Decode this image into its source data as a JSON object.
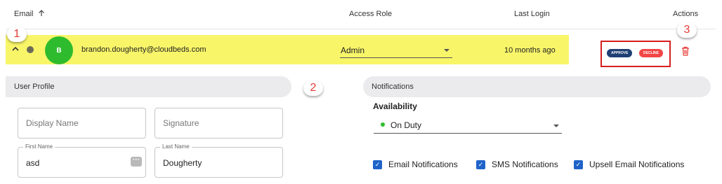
{
  "table": {
    "headers": {
      "email": "Email",
      "access_role": "Access Role",
      "last_login": "Last Login",
      "actions": "Actions"
    },
    "row": {
      "avatar_initial": "B",
      "email": "brandon.dougherty@cloudbeds.com",
      "access_role": "Admin",
      "last_login": "10 months ago",
      "approve_label": "APPROVE",
      "decline_label": "DECLINE"
    }
  },
  "annotations": [
    "1",
    "2",
    "3"
  ],
  "user_profile": {
    "title": "User Profile",
    "display_name_placeholder": "Display Name",
    "signature_placeholder": "Signature",
    "first_name_label": "First Name",
    "first_name_value": "asd",
    "last_name_label": "Last Name",
    "last_name_value": "Dougherty"
  },
  "notifications": {
    "title": "Notifications",
    "availability_label": "Availability",
    "availability_value": "On Duty",
    "checkboxes": [
      {
        "label": "Email Notifications",
        "checked": true
      },
      {
        "label": "SMS Notifications",
        "checked": true
      },
      {
        "label": "Upsell Email Notifications",
        "checked": true
      }
    ]
  },
  "colors": {
    "row_highlight": "#f8f569",
    "avatar": "#2ebc2e",
    "approve": "#1f3f73",
    "decline": "#f24646",
    "checkbox": "#1f63c9",
    "annotation": "#e53935"
  }
}
